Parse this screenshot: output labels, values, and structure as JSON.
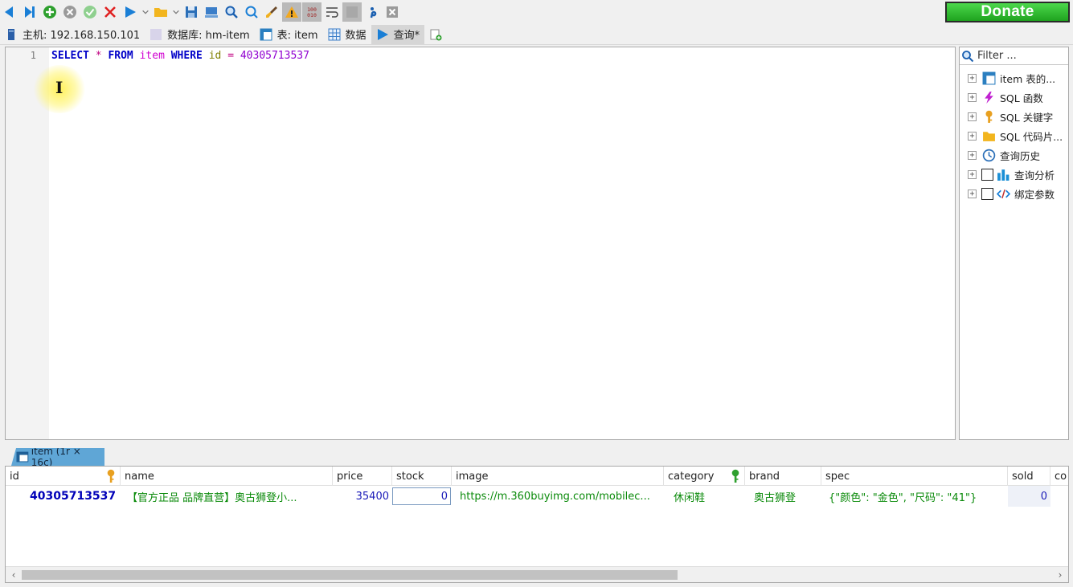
{
  "toolbar": {
    "donate_label": "Donate",
    "icons": [
      "arrow-left-icon",
      "skip-end-icon",
      "add-circle-icon",
      "cancel-circle-icon",
      "check-icon",
      "delete-x-icon",
      "run-icon",
      "chevron-down-icon",
      "folder-icon",
      "chevron-down-icon",
      "save-icon",
      "monitor-icon",
      "search-icon",
      "search-refresh-icon",
      "brush-icon",
      "warning-icon",
      "binary-icon",
      "word-wrap-icon",
      "blank-icon",
      "semicolon-icon",
      "close-box-icon"
    ]
  },
  "tabs": [
    {
      "label": "主机: 192.168.150.101",
      "icon": "server-icon"
    },
    {
      "label": "数据库: hm-item",
      "icon": "database-icon"
    },
    {
      "label": "表: item",
      "icon": "table-icon"
    },
    {
      "label": "数据",
      "icon": "data-grid-icon"
    },
    {
      "label": "查询*",
      "icon": "query-play-icon",
      "active": true
    }
  ],
  "editor": {
    "line_number": "1",
    "tokens": {
      "select": "SELECT",
      "star": "*",
      "from": "FROM",
      "table": "item",
      "where": "WHERE",
      "column": "id",
      "equals": "=",
      "value": "40305713537"
    }
  },
  "right_panel": {
    "filter_placeholder": "Filter ...",
    "items": [
      {
        "label": "item 表的...",
        "icon": "table-icon",
        "checkbox": false
      },
      {
        "label": "SQL 函数",
        "icon": "lightning-icon",
        "checkbox": false
      },
      {
        "label": "SQL 关键字",
        "icon": "key-icon",
        "checkbox": false
      },
      {
        "label": "SQL 代码片...",
        "icon": "folder-icon",
        "checkbox": false
      },
      {
        "label": "查询历史",
        "icon": "clock-icon",
        "checkbox": false
      },
      {
        "label": "查询分析",
        "icon": "bar-chart-icon",
        "checkbox": true
      },
      {
        "label": "绑定参数",
        "icon": "code-icon",
        "checkbox": true
      }
    ]
  },
  "result_tab": {
    "label": "item (1r × 16c)"
  },
  "grid": {
    "columns": [
      "id",
      "name",
      "price",
      "stock",
      "image",
      "category",
      "brand",
      "spec",
      "sold",
      "co"
    ],
    "row": {
      "id": "40305713537",
      "name": "【官方正品 品牌直营】奥古狮登小...",
      "price": "35400",
      "stock": "0",
      "image": "https://m.360buyimg.com/mobilec...",
      "category": "休闲鞋",
      "brand": "奥古狮登",
      "spec": "{\"颜色\": \"金色\", \"尺码\": \"41\"}",
      "sold": "0"
    }
  },
  "colors": {
    "keyword": "#0000c8",
    "table_name": "#d000d0",
    "column": "#808000",
    "number": "#9000d0",
    "donate_green": "#2ec42e",
    "id_blue": "#0000b8",
    "text_green": "#0a8a0a"
  }
}
